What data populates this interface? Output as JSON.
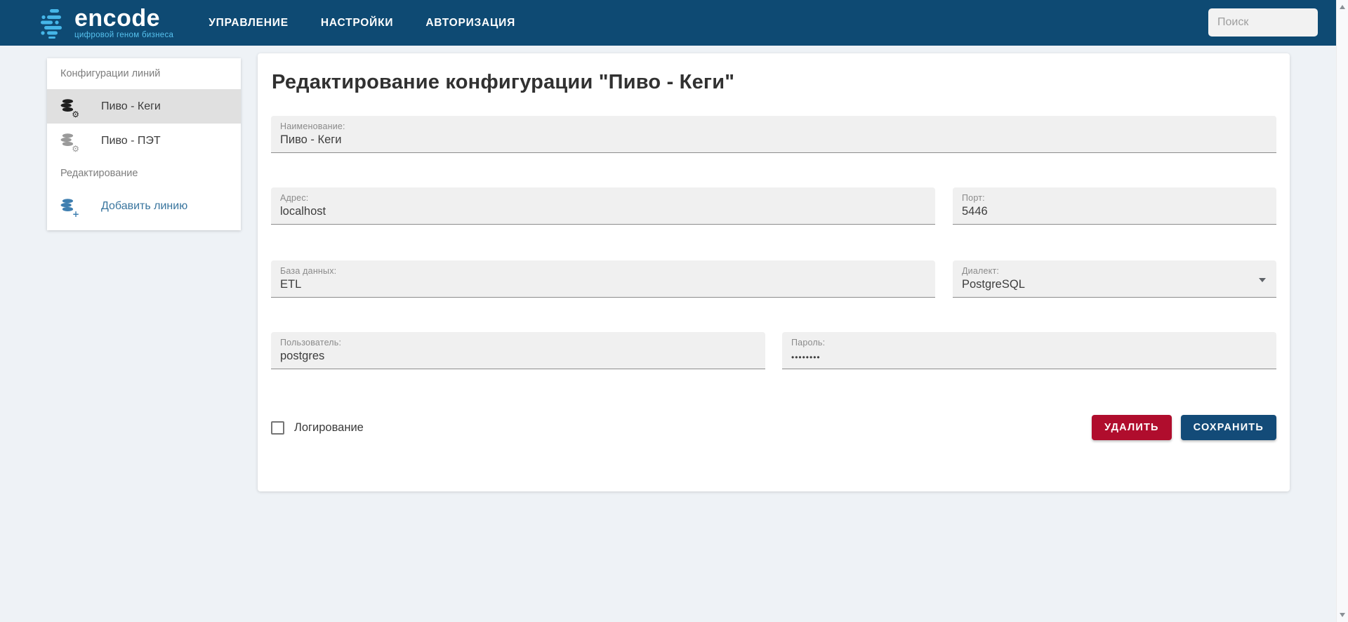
{
  "colors": {
    "navbar_bg": "#0e4a73",
    "logo_accent": "#45b6e8",
    "page_bg": "#eef2f6",
    "delete_button": "#b00d2d",
    "save_button": "#134b78",
    "link_blue": "#39759e",
    "selected_item_bg": "#e0e0e0",
    "field_bg": "#f0f0f0"
  },
  "navbar": {
    "logo_text": "encode",
    "logo_tagline": "цифровой геном бизнеса",
    "links": [
      {
        "label": "УПРАВЛЕНИЕ"
      },
      {
        "label": "НАСТРОЙКИ"
      },
      {
        "label": "АВТОРИЗАЦИЯ"
      }
    ],
    "search_placeholder": "Поиск"
  },
  "sidebar": {
    "section1_title": "Конфигурации линий",
    "items": [
      {
        "label": "Пиво - Кеги",
        "icon": "database-gear-icon",
        "selected": true
      },
      {
        "label": "Пиво - ПЭТ",
        "icon": "database-gear-icon",
        "selected": false
      }
    ],
    "section2_title": "Редактирование",
    "add_item_label": "Добавить линию"
  },
  "main": {
    "title": "Редактирование конфигурации \"Пиво - Кеги\"",
    "fields": {
      "name": {
        "label": "Наименование:",
        "value": "Пиво - Кеги"
      },
      "address": {
        "label": "Адрес:",
        "value": "localhost"
      },
      "port": {
        "label": "Порт:",
        "value": "5446"
      },
      "database": {
        "label": "База данных:",
        "value": "ETL"
      },
      "dialect": {
        "label": "Диалект:",
        "value": "PostgreSQL"
      },
      "user": {
        "label": "Пользователь:",
        "value": "postgres"
      },
      "password": {
        "label": "Пароль:",
        "value": "••••••••"
      }
    },
    "logging_checkbox": {
      "label": "Логирование",
      "checked": false
    },
    "buttons": {
      "delete": "УДАЛИТЬ",
      "save": "СОХРАНИТЬ"
    }
  }
}
